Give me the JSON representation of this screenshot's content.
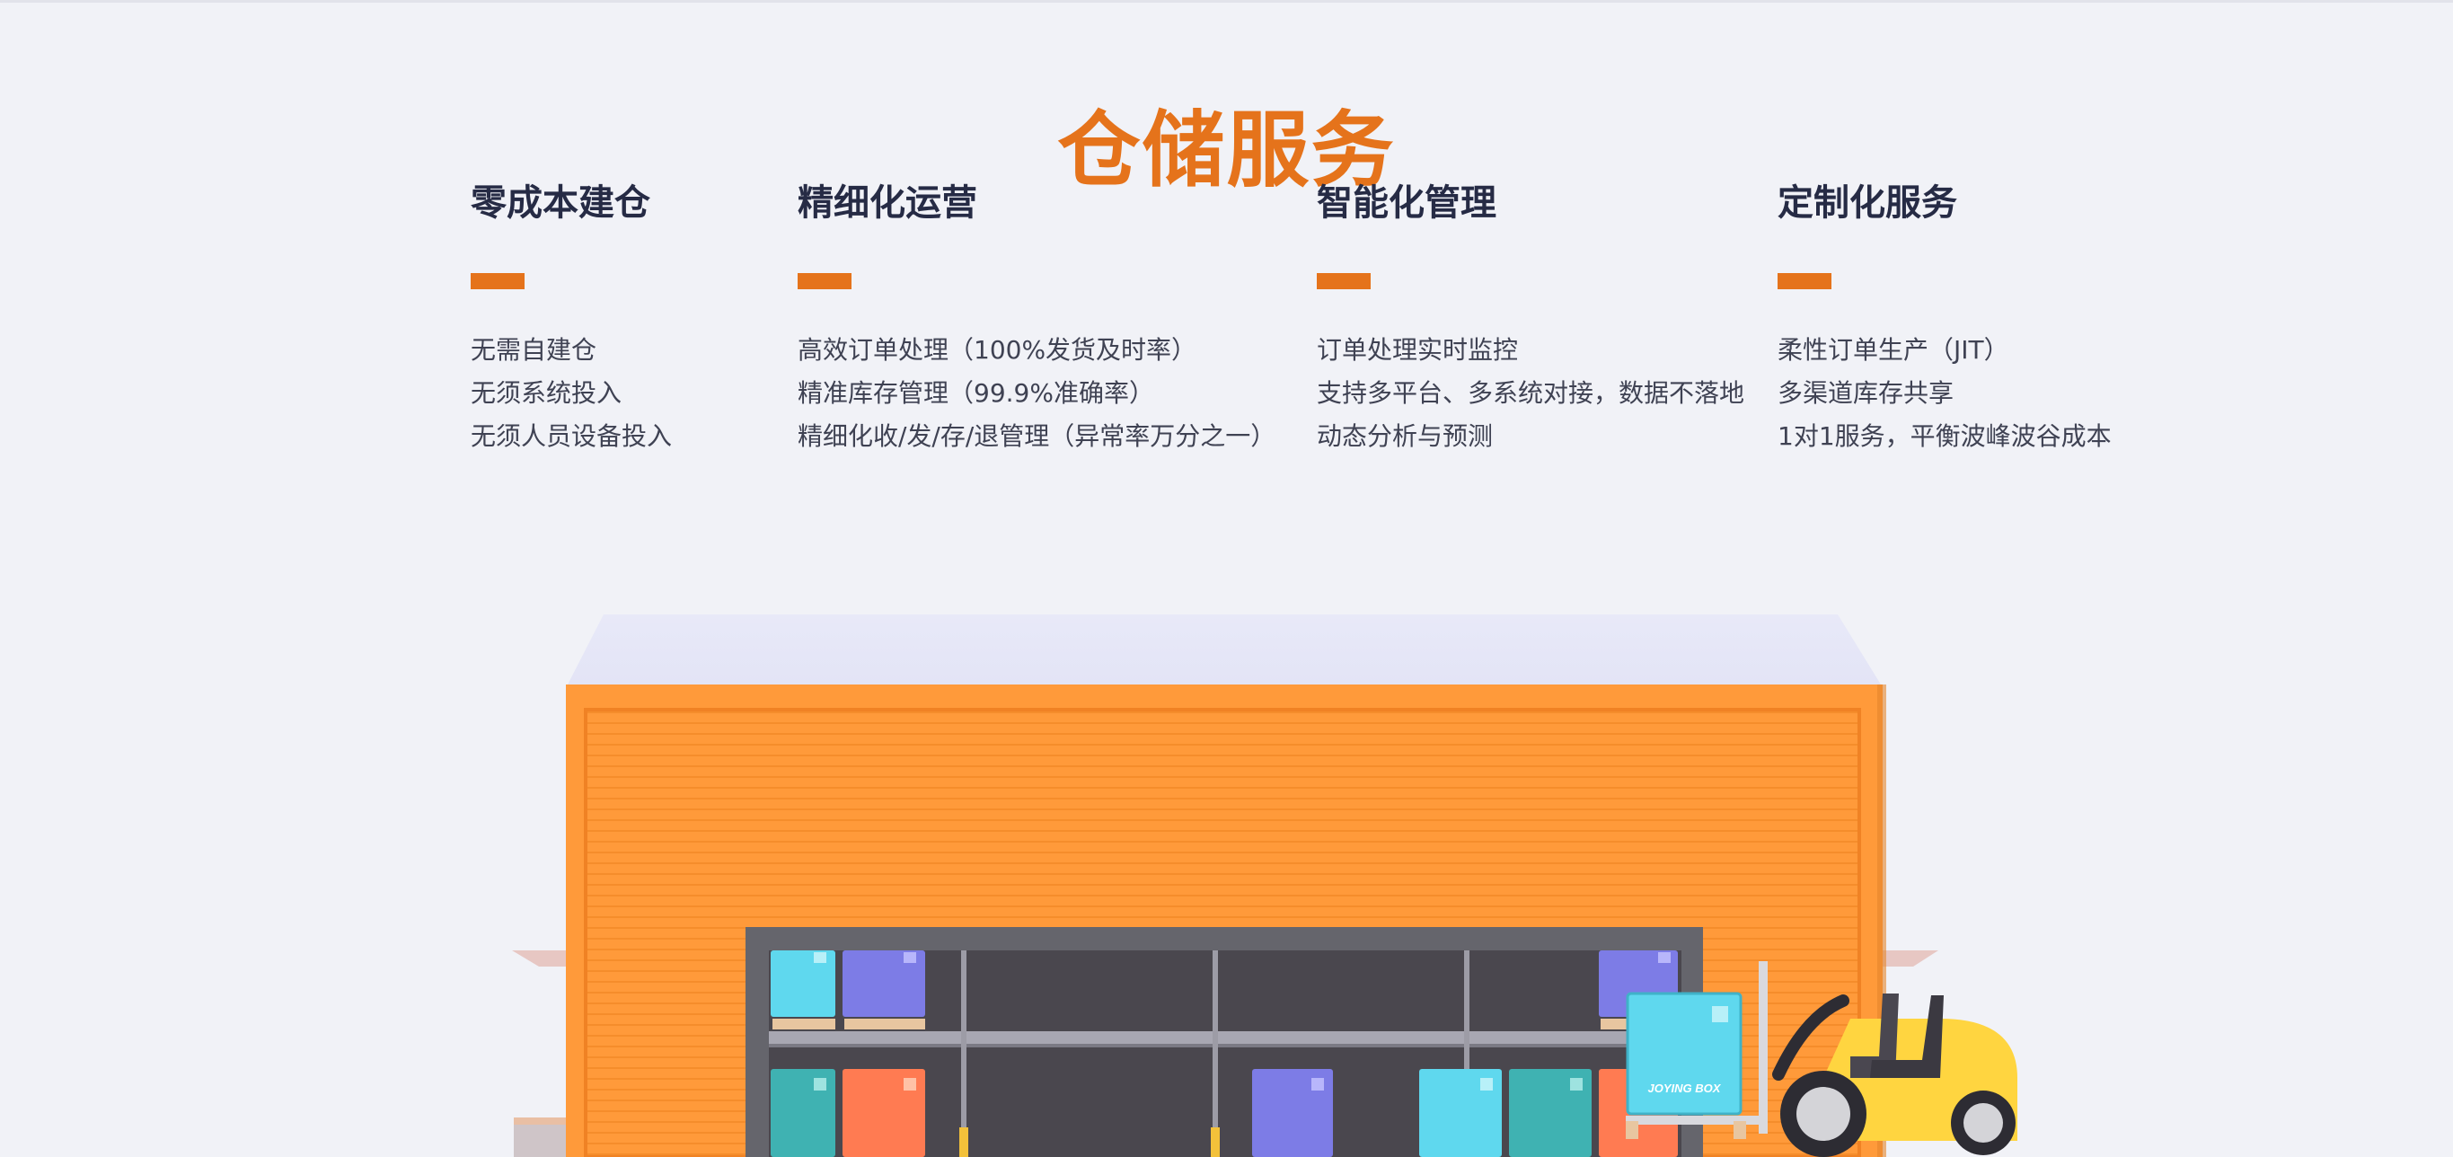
{
  "page": {
    "title": "仓储服务"
  },
  "features": [
    {
      "title": "零成本建仓",
      "items": [
        "无需自建仓",
        "无须系统投入",
        "无须人员设备投入"
      ]
    },
    {
      "title": "精细化运营",
      "items": [
        "高效订单处理（100%发货及时率）",
        "精准库存管理（99.9%准确率）",
        "精细化收/发/存/退管理（异常率万分之一）"
      ]
    },
    {
      "title": "智能化管理",
      "items": [
        "订单处理实时监控",
        "支持多平台、多系统对接，数据不落地",
        "动态分析与预测"
      ]
    },
    {
      "title": "定制化服务",
      "items": [
        "柔性订单生产（JIT）",
        "多渠道库存共享",
        "1对1服务，平衡波峰波谷成本"
      ]
    }
  ],
  "illustration": {
    "box_label": "JOYING BOX"
  },
  "colors": {
    "accent": "#e5731b",
    "heading": "#262b45",
    "body_text": "#3f4253",
    "background": "#f1f2f7"
  }
}
